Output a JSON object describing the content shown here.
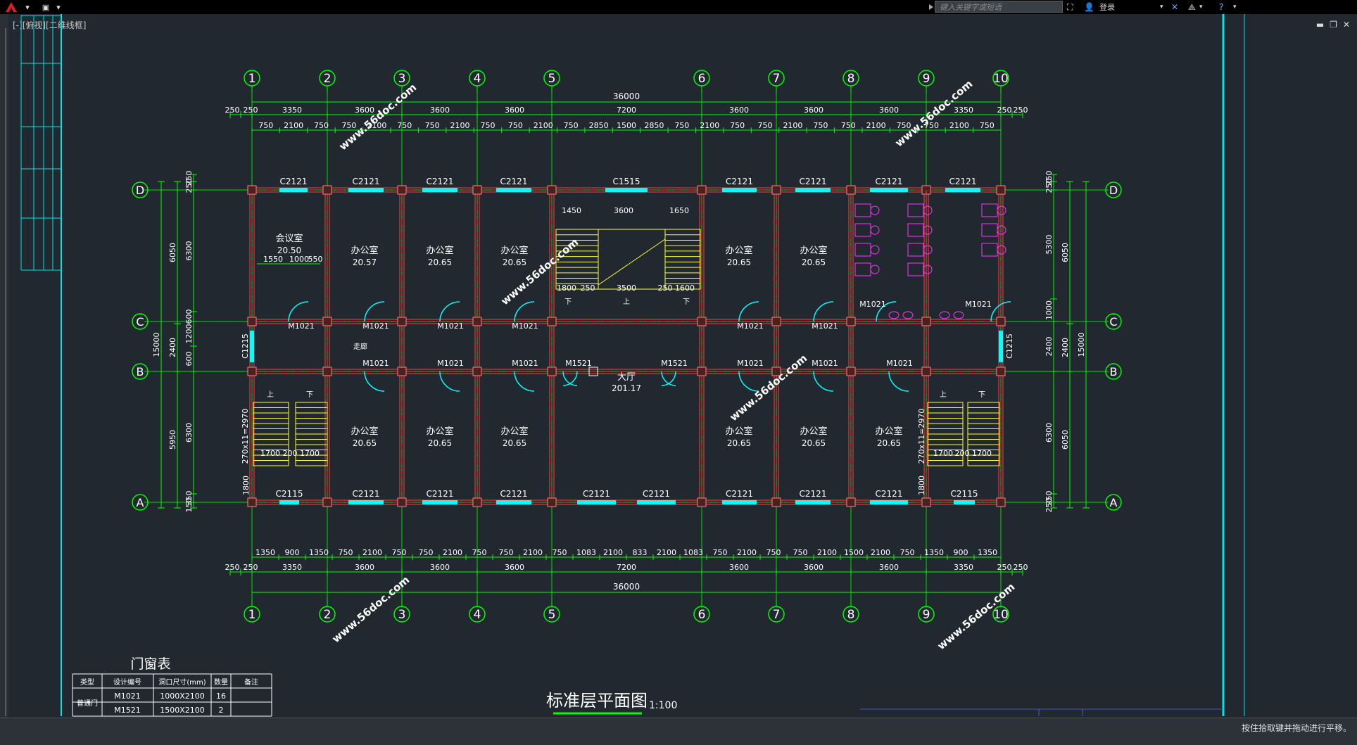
{
  "app": {
    "search_placeholder": "键入关键字或短语",
    "login_label": "登录",
    "viewport_label": "[-][俯视][二维线框]",
    "status_text": "按住拾取键并拖动进行平移。"
  },
  "colors": {
    "background": "#212830",
    "grid": "#00ff00",
    "wall": "#ff3b3b",
    "window": "#00ffff",
    "stair": "#ffff33",
    "fixture": "#ff33ff",
    "text": "#ffffff"
  },
  "drawing": {
    "title": "标准层平面图",
    "scale": "1:100",
    "watermark": "www.56doc.com",
    "axes_numbers": [
      "1",
      "2",
      "3",
      "4",
      "5",
      "6",
      "7",
      "8",
      "9",
      "10"
    ],
    "axes_letters": [
      "D",
      "C",
      "B",
      "A"
    ],
    "dims_top_total": "36000",
    "dims_top_bays": [
      "250",
      "250",
      "3350",
      "3600",
      "3600",
      "3600",
      "7200",
      "3600",
      "3600",
      "3600",
      "3350",
      "250",
      "250"
    ],
    "dims_top_windows": [
      "750",
      "2100",
      "750",
      "750",
      "2100",
      "750",
      "750",
      "2100",
      "750",
      "750",
      "2100",
      "750",
      "2850",
      "1500",
      "2850",
      "750",
      "2100",
      "750",
      "750",
      "2100",
      "750",
      "750",
      "2100",
      "750",
      "750",
      "2100",
      "750"
    ],
    "dims_bottom_total": "36000",
    "dims_bottom_bays": [
      "250",
      "250",
      "3350",
      "3600",
      "3600",
      "3600",
      "7200",
      "3600",
      "3600",
      "3600",
      "3350",
      "250",
      "250"
    ],
    "dims_bottom_windows": [
      "1350",
      "900",
      "1350",
      "750",
      "2100",
      "750",
      "750",
      "2100",
      "750",
      "750",
      "2100",
      "750",
      "1083",
      "2100",
      "833",
      "2100",
      "1083",
      "750",
      "2100",
      "750",
      "750",
      "2100",
      "1500",
      "2100",
      "750",
      "1350",
      "900",
      "1350"
    ],
    "left_dims_outer": [
      "15000"
    ],
    "left_dims_mid": [
      "6050",
      "2400",
      "5950"
    ],
    "left_dims_inner": [
      "250",
      "250",
      "6300",
      "600",
      "1200",
      "600",
      "6300",
      "350",
      "150"
    ],
    "right_dims_outer": [
      "15000"
    ],
    "right_dims_mid": [
      "6050",
      "2400",
      "6050"
    ],
    "right_dims_inner": [
      "250",
      "250",
      "5300",
      "1000",
      "2400",
      "6300",
      "250",
      "250"
    ],
    "windows_top": [
      "C2121",
      "C2121",
      "C2121",
      "C2121",
      "C1515",
      "C2121",
      "C2121",
      "C2121",
      "C2121"
    ],
    "windows_bottom": [
      "C2115",
      "C2121",
      "C2121",
      "C2121",
      "C2121",
      "C2121",
      "C2121",
      "C2121",
      "C2121",
      "C2115"
    ],
    "side_windows": [
      "C1215",
      "C1215"
    ],
    "doors_upper": [
      "M1021",
      "M1021",
      "M1021",
      "M1021",
      "M1021",
      "M1021",
      "M1021",
      "M1021"
    ],
    "doors_lower": [
      "M1021",
      "M1021",
      "M1021",
      "M1521",
      "M1521",
      "M1021",
      "M1021",
      "M1021"
    ],
    "rooms_upper": [
      {
        "name": "会议室",
        "area": "20.50"
      },
      {
        "name": "办公室",
        "area": "20.57"
      },
      {
        "name": "办公室",
        "area": "20.65"
      },
      {
        "name": "办公室",
        "area": "20.65"
      },
      {
        "name": "办公室",
        "area": "20.65"
      },
      {
        "name": "办公室",
        "area": "20.65"
      }
    ],
    "rooms_lower": [
      {
        "name": "办公室",
        "area": "20.65"
      },
      {
        "name": "办公室",
        "area": "20.65"
      },
      {
        "name": "办公室",
        "area": "20.65"
      },
      {
        "name": "办公室",
        "area": "20.65"
      },
      {
        "name": "办公室",
        "area": "20.65"
      },
      {
        "name": "办公室",
        "area": "20.65"
      }
    ],
    "hall": {
      "name": "大厅",
      "area": "201.17"
    },
    "corridor": "走廊",
    "meeting_dims": [
      "1550",
      "1000",
      "550"
    ],
    "stair_center_dims_top": [
      "1450",
      "3600",
      "1650"
    ],
    "stair_center_dims_bottom": [
      "1800",
      "250",
      "3500",
      "250",
      "1600"
    ],
    "stair_side_label": "270x11=2970",
    "stair_side_dims": [
      "1700",
      "200",
      "1700"
    ],
    "stair_side_bottom": "1800",
    "up": "上",
    "down": "下"
  },
  "door_window_table": {
    "title": "门窗表",
    "headers": [
      "类型",
      "设计编号",
      "洞口尺寸(mm)",
      "数量",
      "备注"
    ],
    "group": "普通门",
    "rows": [
      {
        "code": "M1021",
        "size": "1000X2100",
        "qty": "16",
        "note": ""
      },
      {
        "code": "M1521",
        "size": "1500X2100",
        "qty": "2",
        "note": ""
      }
    ]
  }
}
